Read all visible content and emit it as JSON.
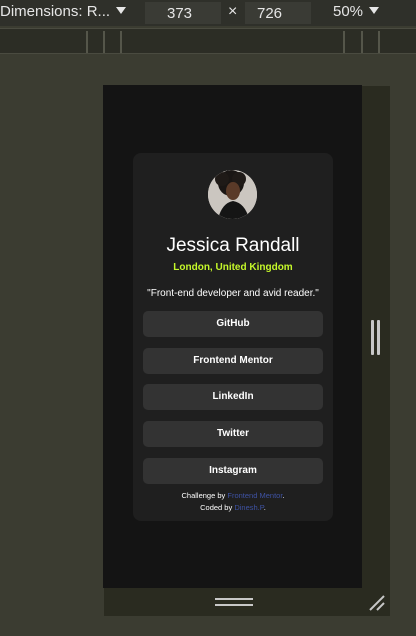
{
  "toolbar": {
    "dimensions_label": "Dimensions: R...",
    "width_value": "373",
    "times": "×",
    "height_value": "726",
    "zoom": "50%"
  },
  "profile": {
    "name": "Jessica Randall",
    "location": "London, United Kingdom",
    "bio": "\"Front-end developer and avid reader.\"",
    "links": [
      {
        "label": "GitHub"
      },
      {
        "label": "Frontend Mentor"
      },
      {
        "label": "LinkedIn"
      },
      {
        "label": "Twitter"
      },
      {
        "label": "Instagram"
      }
    ]
  },
  "attribution": {
    "challenge_prefix": "Challenge by ",
    "challenge_link": "Frontend Mentor",
    "challenge_suffix": ".",
    "coded_prefix": "Coded by ",
    "coded_link": "Dinesh.P",
    "coded_suffix": "."
  },
  "colors": {
    "accent": "#c5f82a",
    "card": "#1f1f1f",
    "button": "#333333",
    "link": "#3e52a3"
  }
}
